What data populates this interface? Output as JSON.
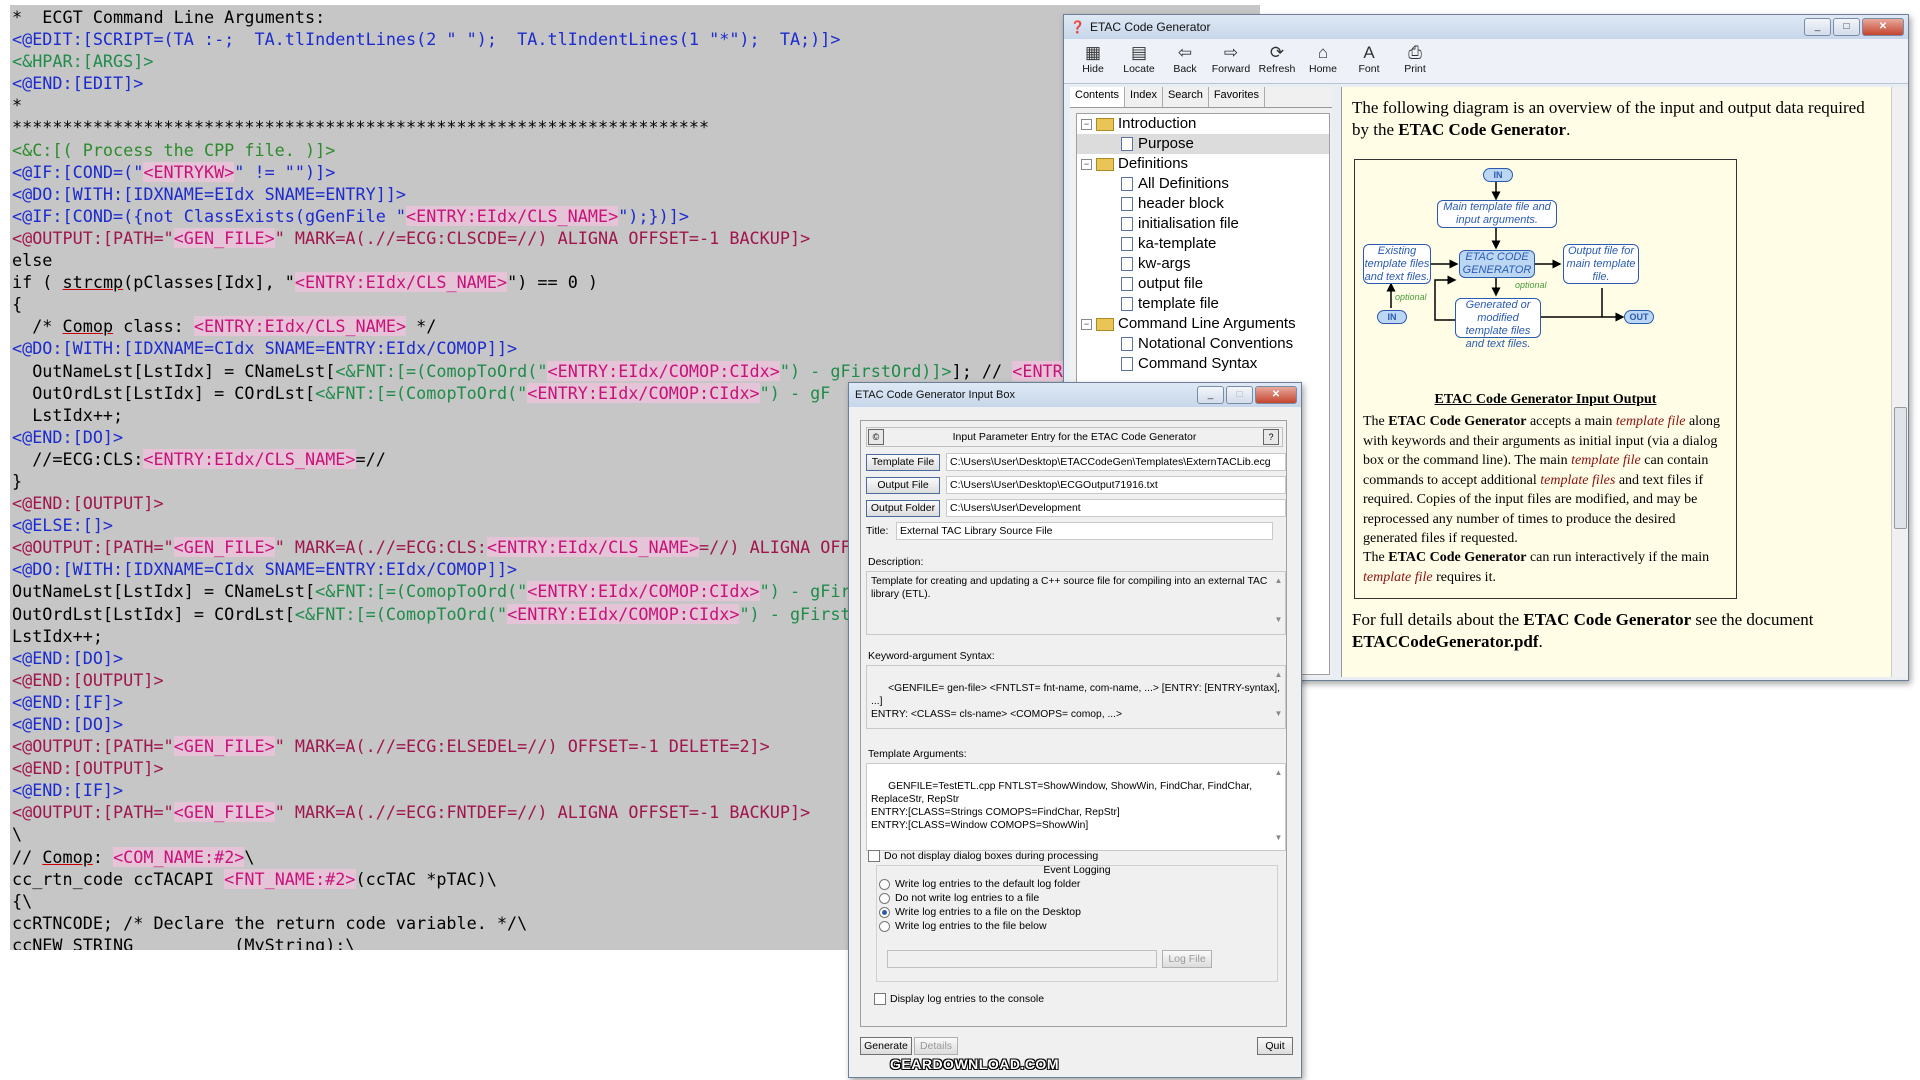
{
  "editor": {
    "lines": [
      [
        {
          "t": "*  ECGT Command Line Arguments:",
          "c": ""
        }
      ],
      [
        {
          "t": "<@EDIT:[SCRIPT=(TA :-;  TA.tlIndentLines(2 \" \");  TA.tlIndentLines(1 \"*\");  TA;)]>",
          "c": "blu"
        }
      ],
      [
        {
          "t": "<&HPAR:[ARGS]>",
          "c": "grn"
        }
      ],
      [
        {
          "t": "<@END:[EDIT]>",
          "c": "blu"
        }
      ],
      [
        {
          "t": "*",
          "c": ""
        }
      ],
      [
        {
          "t": "*********************************************************************",
          "c": ""
        }
      ],
      [
        {
          "t": "<&C:[( Process the CPP file. )]>",
          "c": "cmt"
        }
      ],
      [
        {
          "t": "<@IF:[COND=(\"",
          "c": "blu"
        },
        {
          "t": "<ENTRYKW>",
          "c": "ent"
        },
        {
          "t": "\" != \"\")]>",
          "c": "blu"
        }
      ],
      [
        {
          "t": "<@DO:[WITH:[IDXNAME=EIdx SNAME=ENTRY]]>",
          "c": "blu"
        }
      ],
      [
        {
          "t": "<@IF:[COND=({not ClassExists(gGenFile \"",
          "c": "blu"
        },
        {
          "t": "<ENTRY:EIdx/CLS_NAME>",
          "c": "ent"
        },
        {
          "t": "\");})]>",
          "c": "blu"
        }
      ],
      [
        {
          "t": "<@OUTPUT:[PATH=\"",
          "c": "mar"
        },
        {
          "t": "<GEN_FILE>",
          "c": "ent"
        },
        {
          "t": "\" MARK=A(.//=ECG:CLSCDE=//) ALIGNA OFFSET=-1 BACKUP]>",
          "c": "mar"
        }
      ],
      [
        {
          "t": "else",
          "c": ""
        }
      ],
      [
        {
          "t": "if ( ",
          "c": ""
        },
        {
          "t": "strcmp",
          "c": "und"
        },
        {
          "t": "(pClasses[Idx], \"",
          "c": ""
        },
        {
          "t": "<ENTRY:EIdx/CLS_NAME>",
          "c": "ent"
        },
        {
          "t": "\") == 0 )",
          "c": ""
        }
      ],
      [
        {
          "t": "{",
          "c": ""
        }
      ],
      [
        {
          "t": "  /* ",
          "c": ""
        },
        {
          "t": "Comop",
          "c": "und"
        },
        {
          "t": " class: ",
          "c": ""
        },
        {
          "t": "<ENTRY:EIdx/CLS_NAME>",
          "c": "ent"
        },
        {
          "t": " */",
          "c": ""
        }
      ],
      [
        {
          "t": "<@DO:[WITH:[IDXNAME=CIdx SNAME=ENTRY:EIdx/COMOP]]>",
          "c": "blu"
        }
      ],
      [
        {
          "t": "  OutNameLst[LstIdx] = CNameLst[",
          "c": ""
        },
        {
          "t": "<&FNT:[=(ComopToOrd(\"",
          "c": "fnt"
        },
        {
          "t": "<ENTRY:EIdx/COMOP:CIdx>",
          "c": "ent"
        },
        {
          "t": "\") - gFirstOrd)]>",
          "c": "fnt"
        },
        {
          "t": "]; // ",
          "c": ""
        },
        {
          "t": "<ENTR",
          "c": "ent"
        }
      ],
      [
        {
          "t": "  OutOrdLst[LstIdx] = COrdLst[",
          "c": ""
        },
        {
          "t": "<&FNT:[=(ComopToOrd(\"",
          "c": "fnt"
        },
        {
          "t": "<ENTRY:EIdx/COMOP:CIdx>",
          "c": "ent"
        },
        {
          "t": "\") - gF",
          "c": "fnt"
        }
      ],
      [
        {
          "t": "  LstIdx++;",
          "c": ""
        }
      ],
      [
        {
          "t": "<@END:[DO]>",
          "c": "blu"
        }
      ],
      [
        {
          "t": "  //=ECG:CLS:",
          "c": ""
        },
        {
          "t": "<ENTRY:EIdx/CLS_NAME>",
          "c": "ent"
        },
        {
          "t": "=//",
          "c": ""
        }
      ],
      [
        {
          "t": "}",
          "c": ""
        }
      ],
      [
        {
          "t": "<@END:[OUTPUT]>",
          "c": "mar"
        }
      ],
      [
        {
          "t": "<@ELSE:[]>",
          "c": "blu"
        }
      ],
      [
        {
          "t": "<@OUTPUT:[PATH=\"",
          "c": "mar"
        },
        {
          "t": "<GEN_FILE>",
          "c": "ent"
        },
        {
          "t": "\" MARK=A(.//=ECG:CLS:",
          "c": "mar"
        },
        {
          "t": "<ENTRY:EIdx/CLS_NAME>",
          "c": "ent"
        },
        {
          "t": "=//) ALIGNA OFFS",
          "c": "mar"
        }
      ],
      [
        {
          "t": "<@DO:[WITH:[IDXNAME=CIdx SNAME=ENTRY:EIdx/COMOP]]>",
          "c": "blu"
        }
      ],
      [
        {
          "t": "OutNameLst[LstIdx] = CNameLst[",
          "c": ""
        },
        {
          "t": "<&FNT:[=(ComopToOrd(\"",
          "c": "fnt"
        },
        {
          "t": "<ENTRY:EIdx/COMOP:CIdx>",
          "c": "ent"
        },
        {
          "t": "\") - gFirs",
          "c": "fnt"
        }
      ],
      [
        {
          "t": "OutOrdLst[LstIdx] = COrdLst[",
          "c": ""
        },
        {
          "t": "<&FNT:[=(ComopToOrd(\"",
          "c": "fnt"
        },
        {
          "t": "<ENTRY:EIdx/COMOP:CIdx>",
          "c": "ent"
        },
        {
          "t": "\") - gFirst(",
          "c": "fnt"
        }
      ],
      [
        {
          "t": "LstIdx++;",
          "c": ""
        }
      ],
      [
        {
          "t": "<@END:[DO]>",
          "c": "blu"
        }
      ],
      [
        {
          "t": "<@END:[OUTPUT]>",
          "c": "mar"
        }
      ],
      [
        {
          "t": "<@END:[IF]>",
          "c": "blu"
        }
      ],
      [
        {
          "t": "<@END:[DO]>",
          "c": "blu"
        }
      ],
      [
        {
          "t": "<@OUTPUT:[PATH=\"",
          "c": "mar"
        },
        {
          "t": "<GEN_FILE>",
          "c": "ent"
        },
        {
          "t": "\" MARK=A(.//=ECG:ELSEDEL=//) OFFSET=-1 DELETE=2]>",
          "c": "mar"
        }
      ],
      [
        {
          "t": "<@END:[OUTPUT]>",
          "c": "mar"
        }
      ],
      [
        {
          "t": "<@END:[IF]>",
          "c": "blu"
        }
      ],
      [
        {
          "t": "<@OUTPUT:[PATH=\"",
          "c": "mar"
        },
        {
          "t": "<GEN_FILE>",
          "c": "ent"
        },
        {
          "t": "\" MARK=A(.//=ECG:FNTDEF=//) ALIGNA OFFSET=-1 BACKUP]>",
          "c": "mar"
        }
      ],
      [
        {
          "t": "\\",
          "c": ""
        }
      ],
      [
        {
          "t": "// ",
          "c": ""
        },
        {
          "t": "Comop",
          "c": "und"
        },
        {
          "t": ": ",
          "c": ""
        },
        {
          "t": "<COM_NAME:#2>",
          "c": "ent"
        },
        {
          "t": "\\",
          "c": ""
        }
      ],
      [
        {
          "t": "cc_rtn_code ccTACAPI ",
          "c": ""
        },
        {
          "t": "<FNT_NAME:#2>",
          "c": "ent"
        },
        {
          "t": "(ccTAC *pTAC)\\",
          "c": ""
        }
      ],
      [
        {
          "t": "{\\",
          "c": ""
        }
      ],
      [
        {
          "t": "ccRTNCODE; /* Declare the return code variable. */\\",
          "c": ""
        }
      ],
      [
        {
          "t": "ccNEW STRING          (MyString);\\",
          "c": ""
        }
      ]
    ]
  },
  "help": {
    "title": "ETAC Code Generator",
    "toolbar": [
      {
        "label": "Hide",
        "icon": "hide-icon",
        "glyph": "▦"
      },
      {
        "label": "Locate",
        "icon": "locate-icon",
        "glyph": "▤"
      },
      {
        "label": "Back",
        "icon": "back-arrow-icon",
        "glyph": "⇦"
      },
      {
        "label": "Forward",
        "icon": "forward-arrow-icon",
        "glyph": "⇨"
      },
      {
        "label": "Refresh",
        "icon": "refresh-icon",
        "glyph": "⟳"
      },
      {
        "label": "Home",
        "icon": "home-icon",
        "glyph": "⌂"
      },
      {
        "label": "Font",
        "icon": "font-icon",
        "glyph": "A"
      },
      {
        "label": "Print",
        "icon": "print-icon",
        "glyph": "⎙"
      }
    ],
    "tabs": [
      "Contents",
      "Index",
      "Search",
      "Favorites"
    ],
    "tree": [
      {
        "label": "Introduction",
        "kind": "folder"
      },
      {
        "label": "Purpose",
        "kind": "page",
        "selected": true
      },
      {
        "label": "Definitions",
        "kind": "folder"
      },
      {
        "label": "All Definitions",
        "kind": "page"
      },
      {
        "label": "header block",
        "kind": "page"
      },
      {
        "label": "initialisation file",
        "kind": "page"
      },
      {
        "label": "ka-template",
        "kind": "page"
      },
      {
        "label": "kw-args",
        "kind": "page"
      },
      {
        "label": "output file",
        "kind": "page"
      },
      {
        "label": "template file",
        "kind": "page"
      },
      {
        "label": "Command Line Arguments",
        "kind": "folder"
      },
      {
        "label": "Notational Conventions",
        "kind": "page"
      },
      {
        "label": "Command Syntax",
        "kind": "page"
      }
    ],
    "intro_pre": "The following diagram is an overview of the input and output data required by the ",
    "intro_bold": "ETAC Code Generator",
    "intro_post": ".",
    "diagram": {
      "in_top": "IN",
      "main_template": "Main template file and input arguments.",
      "core": "ETAC CODE GENERATOR",
      "existing": "Existing template files and text files.",
      "output_file": "Output file for main template file.",
      "generated": "Generated or modified template files and text files.",
      "in_bottom": "IN",
      "out": "OUT",
      "optional_1": "optional",
      "optional_2": "optional"
    },
    "caption": "ETAC Code Generator Input Output",
    "para1": [
      {
        "t": "The ",
        "s": ""
      },
      {
        "t": "ETAC Code Generator",
        "s": "b"
      },
      {
        "t": " accepts a main ",
        "s": ""
      },
      {
        "t": "template file",
        "s": "r"
      },
      {
        "t": " along with keywords and their arguments as initial input (via a dialog box or the command line).  The main ",
        "s": ""
      },
      {
        "t": "template file",
        "s": "r"
      },
      {
        "t": " can contain commands to accept additional ",
        "s": ""
      },
      {
        "t": "template files",
        "s": "r"
      },
      {
        "t": " and text files if required.  Copies of the input files are modified, and may be reprocessed any number of times to produce the desired generated files if requested.",
        "s": ""
      }
    ],
    "para2": [
      {
        "t": "The ",
        "s": ""
      },
      {
        "t": "ETAC Code Generator",
        "s": "b"
      },
      {
        "t": " can run interactively if the main ",
        "s": ""
      },
      {
        "t": "template file",
        "s": "r"
      },
      {
        "t": " requires it.",
        "s": ""
      }
    ],
    "para3": [
      {
        "t": "For full details about the ",
        "s": ""
      },
      {
        "t": "ETAC Code Generator",
        "s": "b"
      },
      {
        "t": " see the document ",
        "s": ""
      },
      {
        "t": "ETACCodeGenerator.pdf",
        "s": "b"
      },
      {
        "t": ".",
        "s": ""
      }
    ]
  },
  "inputbox": {
    "title": "ETAC Code Generator Input Box",
    "header": "Input Parameter Entry for the ETAC Code Generator",
    "template_file_btn": "Template File",
    "template_file_val": "C:\\Users\\User\\Desktop\\ETACCodeGen\\Templates\\ExternTACLib.ecg",
    "output_file_btn": "Output File",
    "output_file_val": "C:\\Users\\User\\Desktop\\ECGOutput71916.txt",
    "output_folder_btn": "Output Folder",
    "output_folder_val": "C:\\Users\\User\\Development",
    "title_label": "Title:",
    "title_val": "External TAC Library Source File",
    "desc_label": "Description:",
    "desc_val": "Template for creating and updating a C++ source file for compiling into an external TAC library (ETL).",
    "kw_label": "Keyword-argument Syntax:",
    "kw_val": "<GENFILE= gen-file> <FNTLST= fnt-name, com-name, ...> [ENTRY: [ENTRY-syntax], ...]\nENTRY: <CLASS= cls-name> <COMOPS= comop, ...>",
    "ta_label": "Template Arguments:",
    "ta_val": "GENFILE=TestETL.cpp FNTLST=ShowWindow, ShowWin, FindChar, FindChar, ReplaceStr, RepStr\nENTRY:[CLASS=Strings COMOPS=FindChar, RepStr]\nENTRY:[CLASS=Window COMOPS=ShowWin]",
    "no_dialog": "Do not display dialog boxes during processing",
    "event_logging": "Event Logging",
    "log_options": [
      {
        "label": "Write log entries to the default log folder",
        "on": false
      },
      {
        "label": "Do not write log entries to a file",
        "on": false
      },
      {
        "label": "Write log entries to a file on the Desktop",
        "on": true
      },
      {
        "label": "Write log entries to the file below",
        "on": false
      }
    ],
    "log_file_btn": "Log File",
    "display_console": "Display log entries to the console",
    "generate_btn": "Generate",
    "details_btn": "Details",
    "quit_btn": "Quit"
  },
  "watermark": "GEARDOWNLOAD.COM"
}
